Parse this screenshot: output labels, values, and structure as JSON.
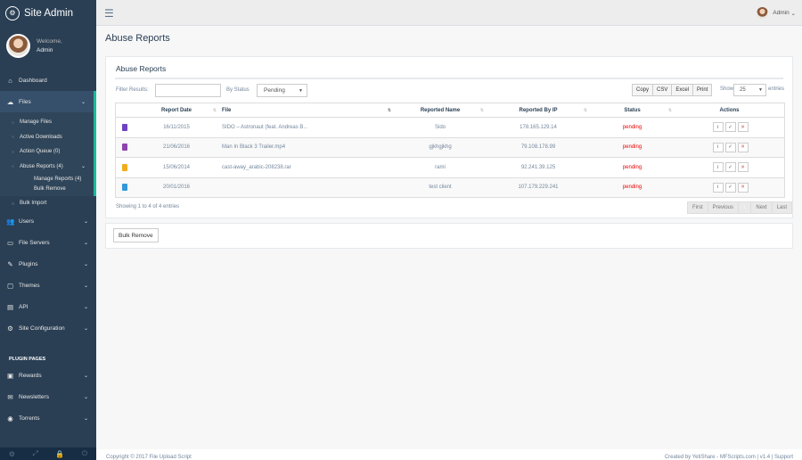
{
  "sidebar": {
    "brand": "Site Admin",
    "welcome": "Welcome,",
    "user": "Admin",
    "items": [
      {
        "label": "Dashboard",
        "icon": "home-icon"
      },
      {
        "label": "Files",
        "icon": "cloud-icon"
      },
      {
        "label": "Users",
        "icon": "users-icon"
      },
      {
        "label": "File Servers",
        "icon": "server-icon"
      },
      {
        "label": "Plugins",
        "icon": "plug-icon"
      },
      {
        "label": "Themes",
        "icon": "desktop-icon"
      },
      {
        "label": "API",
        "icon": "api-icon"
      },
      {
        "label": "Site Configuration",
        "icon": "gear-icon"
      }
    ],
    "files_sub": {
      "manage_files": "Manage Files",
      "active_downloads": "Active Downloads",
      "action_queue": "Action Queue (0)",
      "abuse_reports": "Abuse Reports (4)",
      "manage_reports": "Manage Reports (4)",
      "bulk_remove": "Bulk Remove",
      "bulk_import": "Bulk Import"
    },
    "plugin_section": "PLUGIN PAGES",
    "plugin_items": [
      {
        "label": "Rewards",
        "icon": "gift-icon"
      },
      {
        "label": "Newsletters",
        "icon": "envelope-icon"
      },
      {
        "label": "Torrents",
        "icon": "torrent-icon"
      }
    ]
  },
  "topbar": {
    "user": "Admin"
  },
  "page": {
    "title": "Abuse Reports"
  },
  "panel": {
    "title": "Abuse Reports",
    "filter_label": "Filter Results:",
    "status_label": "By Status",
    "status_value": "Pending",
    "export_buttons": [
      "Copy",
      "CSV",
      "Excel",
      "Print"
    ],
    "show_label": "Show",
    "show_value": "25",
    "entries_label": "entries",
    "columns": [
      "Report Date",
      "File",
      "Reported Name",
      "Reported By IP",
      "Status",
      "Actions"
    ],
    "rows": [
      {
        "date": "16/11/2015",
        "file": "SIDO – Astronaut (feat. Andreas B...",
        "name": "Sido",
        "ip": "178.165.129.14",
        "status": "pending",
        "icon_color": "#6f42c1"
      },
      {
        "date": "21/06/2016",
        "file": "Man In Black 3 Trailer.mp4",
        "name": "gjkhgjkhg",
        "ip": "79.108.178.99",
        "status": "pending",
        "icon_color": "#8e44ad"
      },
      {
        "date": "15/06/2014",
        "file": "cast-away_arabic-208238.rar",
        "name": "rami",
        "ip": "92.241.39.125",
        "status": "pending",
        "icon_color": "#f0ad1e"
      },
      {
        "date": "20/01/2016",
        "file": "",
        "name": "test client",
        "ip": "107.179.229.241",
        "status": "pending",
        "icon_color": "#3498db"
      }
    ],
    "showing": "Showing 1 to 4 of 4 entries",
    "pager": [
      "First",
      "Previous",
      "1",
      "Next",
      "Last"
    ],
    "bulk_button": "Bulk Remove"
  },
  "footer": {
    "left": "Copyright © 2017 File Upload Script",
    "right": "Created by YetiShare - MFScripts.com  |  v1.4  |  Support"
  }
}
